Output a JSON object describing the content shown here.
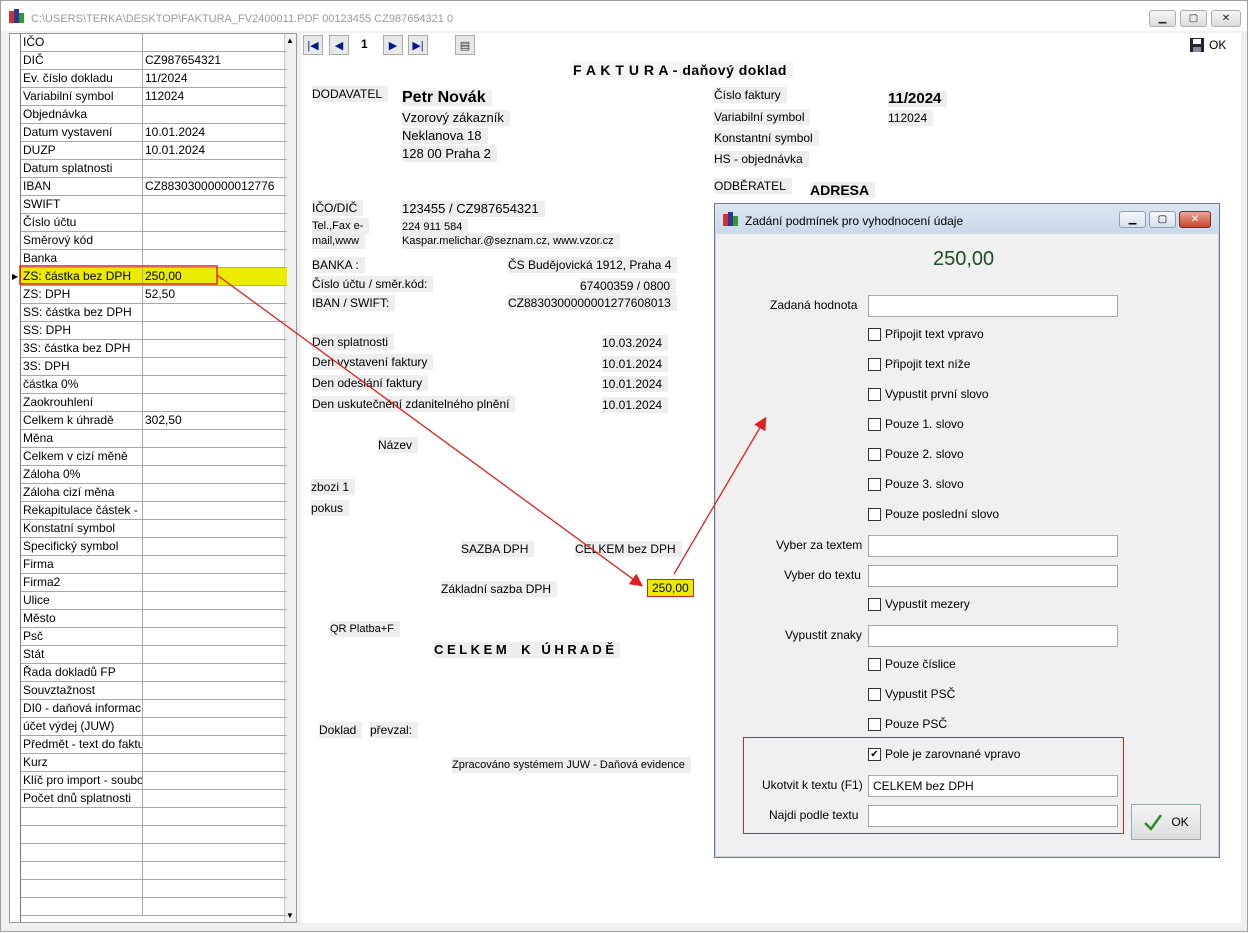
{
  "window": {
    "title": "C:\\USERS\\TERKA\\DESKTOP\\FAKTURA_FV2400011.PDF 00123455 CZ987654321 0"
  },
  "grid": {
    "rows": [
      [
        "IČO",
        ""
      ],
      [
        "DIČ",
        "CZ987654321"
      ],
      [
        "Ev. číslo dokladu",
        "11/2024"
      ],
      [
        "Variabilní symbol",
        "112024"
      ],
      [
        "Objednávka",
        ""
      ],
      [
        "Datum vystavení",
        "10.01.2024"
      ],
      [
        "DUZP",
        "10.01.2024"
      ],
      [
        "Datum splatnosti",
        ""
      ],
      [
        "IBAN",
        "CZ88303000000012776"
      ],
      [
        "SWIFT",
        ""
      ],
      [
        "Číslo účtu",
        ""
      ],
      [
        "Směrový kód",
        ""
      ],
      [
        "Banka",
        ""
      ],
      [
        "ZS: částka bez DPH",
        "250,00"
      ],
      [
        "ZS: DPH",
        "52,50"
      ],
      [
        "SS: částka bez DPH",
        ""
      ],
      [
        "SS: DPH",
        ""
      ],
      [
        "3S: částka bez DPH",
        ""
      ],
      [
        "3S: DPH",
        ""
      ],
      [
        "částka 0%",
        ""
      ],
      [
        "Zaokrouhlení",
        ""
      ],
      [
        "Celkem k úhradě",
        "302,50"
      ],
      [
        "Měna",
        ""
      ],
      [
        "Celkem v cizí měně",
        ""
      ],
      [
        "Záloha 0%",
        ""
      ],
      [
        "Záloha cizí měna",
        ""
      ],
      [
        "Rekapitulace částek -",
        ""
      ],
      [
        "Konstatní symbol",
        ""
      ],
      [
        "Specifický symbol",
        ""
      ],
      [
        "Firma",
        ""
      ],
      [
        "Firma2",
        ""
      ],
      [
        "Ulice",
        ""
      ],
      [
        "Město",
        ""
      ],
      [
        "Psč",
        ""
      ],
      [
        "Stát",
        ""
      ],
      [
        "Řada dokladů FP",
        ""
      ],
      [
        "Souvztažnost",
        ""
      ],
      [
        "DI0 - daňová informac",
        ""
      ],
      [
        "účet výdej (JUW)",
        ""
      ],
      [
        "Předmět - text do faktu",
        ""
      ],
      [
        "Kurz",
        ""
      ],
      [
        "Klíč pro import - soubo",
        ""
      ],
      [
        "Počet dnů splatnosti",
        ""
      ]
    ]
  },
  "toolbar": {
    "page": "1",
    "ok_label": "OK"
  },
  "invoice": {
    "title": "F A K T U R A - daňový doklad",
    "dodavatel_label": "DODAVATEL",
    "supplier_name": "Petr Novák",
    "supplier_lines": [
      "Vzorový zákazník",
      "Neklanova 18",
      "128 00 Praha 2"
    ],
    "ico_label": "IČO/DIČ",
    "ico_value": "123455 / CZ987654321",
    "tel_label": "Tel.,Fax e-",
    "mail_label": "mail,www",
    "tel_value": "224 911 584",
    "mail_value": "Kaspar.melichar.@seznam.cz, www.vzor.cz",
    "banka_label": "BANKA :",
    "banka_value": "ČS Budějovická 1912, Praha 4",
    "ucet_label": "Číslo účtu / směr.kód:",
    "ucet_value": "67400359 / 0800",
    "iban_label": "IBAN / SWIFT:",
    "iban_value": "CZ8830300000001277608013",
    "den_splatnosti": "Den splatnosti",
    "den_splatnosti_v": "10.03.2024",
    "den_vystaveni": "Den vystavení faktury",
    "den_vystaveni_v": "10.01.2024",
    "den_odeslani": "Den odeslání faktury",
    "den_odeslani_v": "10.01.2024",
    "den_uskut": "Den uskutečnění zdanitelného plnění",
    "den_uskut_v": "10.01.2024",
    "nazev": "Název",
    "zbozi": "zbozi 1",
    "pokus": "pokus",
    "sazba": "SAZBA DPH",
    "celkem_bez": "CELKEM bez DPH",
    "zakladni": "Základní sazba DPH",
    "zakladni_v": "250,00",
    "qr": "QR Platba+F",
    "celkem_k_uhrade": "C E L K E M    K   Ú H R A D Ě",
    "doklad": "Doklad",
    "prevzal": "převzal:",
    "zpracovano": "Zpracováno systémem JUW - Daňová evidence",
    "cislo_faktury": "Číslo faktury",
    "cislo_faktury_v": "11/2024",
    "var_symbol": "Variabilní symbol",
    "var_symbol_v": "112024",
    "konst_symbol": "Konstantní symbol",
    "hs": "HS - objednávka",
    "odberatel": "ODBĚRATEL",
    "adresa": "ADRESA"
  },
  "dialog": {
    "title": "Zadání podmínek pro vyhodnocení údaje",
    "value": "250,00",
    "zadana_hodnota": "Zadaná hodnota",
    "checks": [
      "Připojit text vpravo",
      "Připojit text níže",
      "Vypustit první slovo",
      "Pouze 1. slovo",
      "Pouze 2. slovo",
      "Pouze 3. slovo",
      "Pouze poslední slovo"
    ],
    "vyber_za": "Vyber za textem",
    "vyber_do": "Vyber do textu",
    "vypustit_mezery": "Vypustit mezery",
    "vypustit_znaky": "Vypustit znaky",
    "pouze_cislice": "Pouze číslice",
    "vypustit_psc": "Vypustit PSČ",
    "pouze_psc": "Pouze PSČ",
    "zarovnane": "Pole je zarovnané vpravo",
    "ukotvit": "Ukotvit k textu (F1)",
    "ukotvit_value": "CELKEM bez DPH",
    "najdi": "Najdi podle textu",
    "ok": "OK"
  }
}
